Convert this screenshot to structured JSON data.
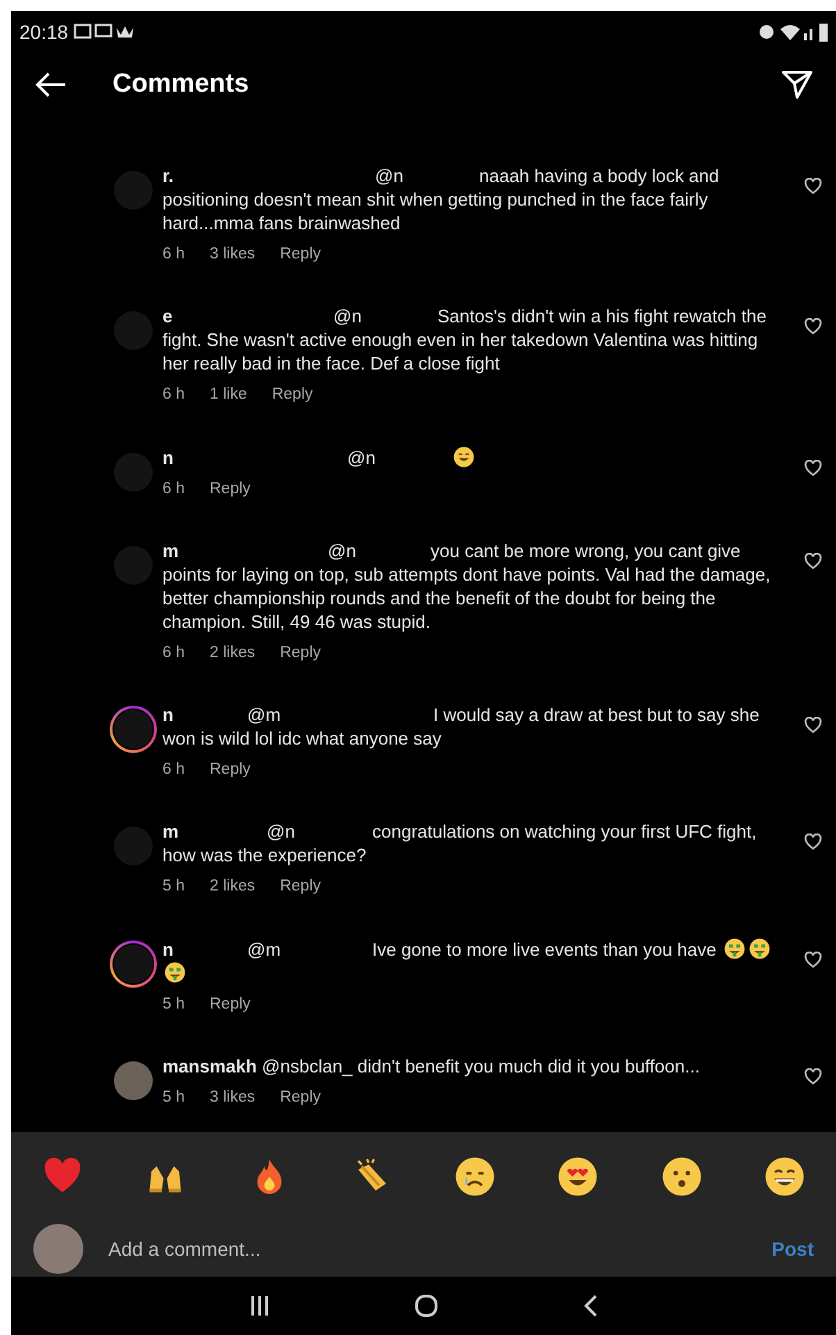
{
  "status_bar": {
    "time": "20:18"
  },
  "header": {
    "title": "Comments"
  },
  "comments": [
    {
      "user": "r.",
      "mention": "@n",
      "ring": false,
      "photo": false,
      "body": [
        {
          "kind": "text",
          "text": "naaah having a body lock and positioning doesn't mean shit when getting punched in the face fairly hard...mma fans brainwashed"
        }
      ],
      "time": "6 h",
      "likes": "3 likes",
      "reply": "Reply"
    },
    {
      "user": "e",
      "mention": "@n",
      "ring": false,
      "photo": false,
      "body": [
        {
          "kind": "text",
          "text": "Santos's didn't win a his fight rewatch the fight. She wasn't active enough even in her takedown Valentina was hitting her really bad in the face. Def a close fight"
        }
      ],
      "time": "6 h",
      "likes": "1 like",
      "reply": "Reply"
    },
    {
      "user": "n",
      "mention": "@n",
      "ring": false,
      "photo": false,
      "body": [
        {
          "kind": "smile-emoji"
        }
      ],
      "time": "6 h",
      "reply": "Reply"
    },
    {
      "user": "m",
      "mention": "@n",
      "ring": false,
      "photo": false,
      "body": [
        {
          "kind": "text",
          "text": "you cant be more wrong, you cant give points for laying on top, sub attempts dont have points. Val had the damage, better championship rounds and the benefit of the doubt for being the champion. Still, 49 46 was stupid."
        }
      ],
      "time": "6 h",
      "likes": "2 likes",
      "reply": "Reply"
    },
    {
      "user": "n",
      "mention": "@m",
      "ring": true,
      "photo": false,
      "body": [
        {
          "kind": "text",
          "text": "I would say a draw at best but to say she won is wild lol idc what anyone say"
        }
      ],
      "time": "6 h",
      "reply": "Reply"
    },
    {
      "user": "m",
      "mention": "@n",
      "ring": false,
      "photo": false,
      "body": [
        {
          "kind": "text",
          "text": "congratulations on watching your first UFC fight, how was the experience?"
        }
      ],
      "time": "5 h",
      "likes": "2 likes",
      "reply": "Reply"
    },
    {
      "user": "n",
      "mention": "@m",
      "ring": true,
      "photo": false,
      "body": [
        {
          "kind": "text",
          "text": "Ive gone to more live events than you have"
        },
        {
          "kind": "money-emoji"
        },
        {
          "kind": "money-emoji"
        },
        {
          "kind": "money-emoji"
        }
      ],
      "time": "5 h",
      "reply": "Reply"
    },
    {
      "user": "mansmakh",
      "mention": "@nsbclan_",
      "ring": false,
      "photo": true,
      "body": [
        {
          "kind": "text",
          "text": "didn't benefit you much did it you buffoon..."
        }
      ],
      "time": "5 h",
      "likes": "3 likes",
      "reply": "Reply"
    }
  ],
  "reactions": [
    {
      "kind": "heart"
    },
    {
      "kind": "raised-hands"
    },
    {
      "kind": "fire"
    },
    {
      "kind": "clap"
    },
    {
      "kind": "crying"
    },
    {
      "kind": "heart-eyes"
    },
    {
      "kind": "surprised"
    },
    {
      "kind": "grin"
    }
  ],
  "composer": {
    "placeholder": "Add a comment...",
    "post": "Post"
  }
}
